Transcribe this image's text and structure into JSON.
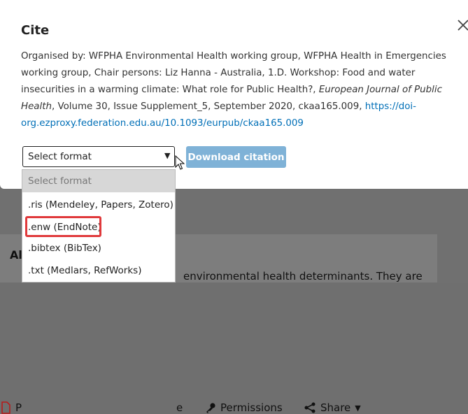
{
  "background": {
    "toolbar": {
      "pdf_label": "P",
      "share_partial_label": "e",
      "permissions_label": "Permissions",
      "share_label": "Share"
    },
    "abstract_heading": "Al",
    "body_text": "environmental health determinants. They are"
  },
  "modal": {
    "title": "Cite",
    "citation": {
      "text": "Organised by: WFPHA Environmental Health working group, WFPHA Health in Emergencies working group, Chair persons: Liz Hanna - Australia, 1.D. Workshop: Food and water insecurities in a warming climate: What role for Public Health?, ",
      "journal": "European Journal of Public Health",
      "details": ", Volume 30, Issue Supplement_5, September 2020, ckaa165.009, ",
      "doi_link": "https://doi-org.ezproxy.federation.edu.au/10.1093/eurpub/ckaa165.009"
    },
    "format_select": {
      "value": "Select format",
      "options": [
        "Select format",
        ".ris (Mendeley, Papers, Zotero)",
        ".enw (EndNote)",
        ".bibtex (BibTex)",
        ".txt (Medlars, RefWorks)"
      ],
      "highlighted_index": 2
    },
    "download_button": "Download citation"
  },
  "colors": {
    "link": "#006fb7",
    "button": "#7fb2d7",
    "highlight": "#e0393b"
  }
}
